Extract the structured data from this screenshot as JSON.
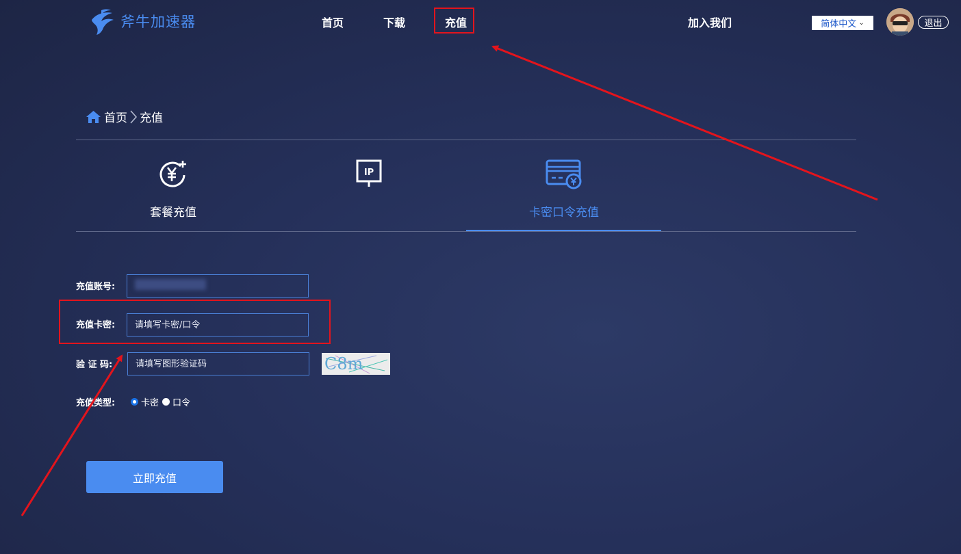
{
  "header": {
    "logo_text": "斧牛加速器",
    "nav": [
      {
        "label": "首页"
      },
      {
        "label": "下载"
      },
      {
        "label": "充值"
      },
      {
        "label": "加入我们"
      }
    ],
    "language": "简体中文",
    "logout_label": "退出"
  },
  "breadcrumb": {
    "home": "首页",
    "current": "充值"
  },
  "tabs": [
    {
      "label": "套餐充值",
      "icon": "yuan-plus-icon"
    },
    {
      "label": "",
      "icon": "ip-icon"
    },
    {
      "label": "卡密口令充值",
      "icon": "card-yuan-icon",
      "active": true
    }
  ],
  "form": {
    "account_label": "充值账号:",
    "card_label": "充值卡密:",
    "card_placeholder": "请填写卡密/口令",
    "captcha_label": "验 证 码:",
    "captcha_placeholder": "请填写图形验证码",
    "captcha_text": "C8m",
    "type_label": "充值类型:",
    "type_options": [
      {
        "label": "卡密",
        "checked": true
      },
      {
        "label": "口令",
        "checked": false
      }
    ],
    "submit_label": "立即充值"
  },
  "colors": {
    "accent": "#4a8cf0",
    "annotation_red": "#e3141c",
    "background": "#25305a"
  }
}
